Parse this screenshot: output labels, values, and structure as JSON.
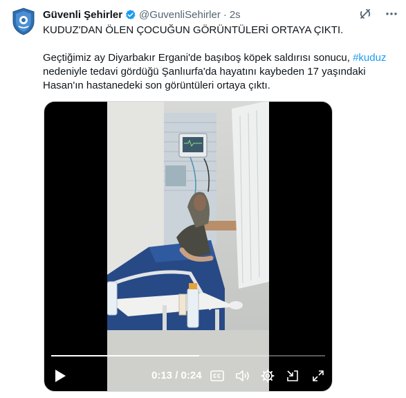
{
  "author": {
    "display_name": "Güvenli Şehirler",
    "handle": "@GuvenliSehirler",
    "separator": "·",
    "time": "2s"
  },
  "tweet": {
    "headline": "KUDUZ'DAN ÖLEN ÇOCUĞUN GÖRÜNTÜLERİ ORTAYA ÇIKTI.",
    "body_before_hashtag": "Geçtiğimiz ay Diyarbakır Ergani'de başıboş köpek saldırısı sonucu, ",
    "hashtag": "#kuduz",
    "body_after_hashtag": " nedeniyle tedavi gördüğü Şanlıurfa'da hayatını kaybeden 17 yaşındaki Hasan'ın hastanedeki son görüntüleri ortaya çıktı."
  },
  "video": {
    "time_display": "0:13 / 0:24",
    "progress_fraction": 0.54
  },
  "icons": {
    "avatar": "shield-logo",
    "verified": "verified-badge-icon",
    "grok": "grok-icon",
    "more": "more-icon",
    "play": "play-icon",
    "captions": "captions-icon",
    "volume": "volume-icon",
    "settings": "settings-icon",
    "pip": "pip-icon",
    "fullscreen": "fullscreen-icon"
  },
  "colors": {
    "accent": "#1d9bf0",
    "text": "#0f1419",
    "secondary_text": "#536471"
  }
}
